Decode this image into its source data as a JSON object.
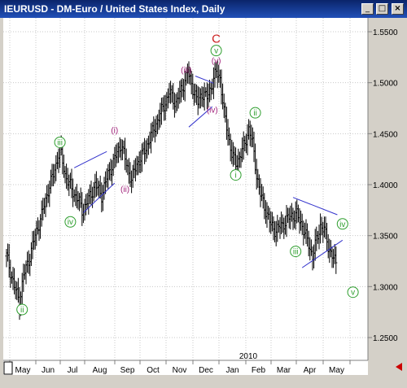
{
  "window": {
    "title": "IEURUSD - DM-Euro / United States Index, Daily",
    "minimize_icon": "minimize-icon",
    "maximize_icon": "maximize-icon",
    "close_icon": "close-icon"
  },
  "scroll_arrow_color": "#cc0000",
  "colors": {
    "wave_green": "#2e9e2e",
    "wave_purple": "#a0207a",
    "wave_red": "#cc2222",
    "trendline": "#3333cc",
    "bars": "#000000"
  },
  "chart_data": {
    "type": "ohlc-bar",
    "symbol": "IEURUSD",
    "title": "IEURUSD - DM-Euro / United States Index, Daily",
    "x_axis": {
      "months": [
        "May",
        "Jun",
        "Jul",
        "Aug",
        "Sep",
        "Oct",
        "Nov",
        "Dec",
        "Jan",
        "Feb",
        "Mar",
        "Apr",
        "May"
      ],
      "year_label": "2010"
    },
    "y_axis": {
      "ticks": [
        "1.5500",
        "1.5000",
        "1.4500",
        "1.4000",
        "1.3500",
        "1.3000",
        "1.2500"
      ],
      "ylim": [
        1.22,
        1.565
      ]
    },
    "price_path": [
      [
        0,
        1.33
      ],
      [
        6,
        1.3
      ],
      [
        10,
        1.285
      ],
      [
        13,
        1.31
      ],
      [
        18,
        1.33
      ],
      [
        22,
        1.35
      ],
      [
        27,
        1.37
      ],
      [
        32,
        1.395
      ],
      [
        36,
        1.41
      ],
      [
        41,
        1.435
      ],
      [
        45,
        1.41
      ],
      [
        50,
        1.395
      ],
      [
        55,
        1.385
      ],
      [
        58,
        1.375
      ],
      [
        63,
        1.385
      ],
      [
        68,
        1.4
      ],
      [
        73,
        1.39
      ],
      [
        78,
        1.41
      ],
      [
        83,
        1.425
      ],
      [
        88,
        1.44
      ],
      [
        92,
        1.42
      ],
      [
        96,
        1.405
      ],
      [
        100,
        1.42
      ],
      [
        105,
        1.43
      ],
      [
        110,
        1.445
      ],
      [
        115,
        1.46
      ],
      [
        120,
        1.475
      ],
      [
        125,
        1.49
      ],
      [
        130,
        1.48
      ],
      [
        135,
        1.495
      ],
      [
        139,
        1.51
      ],
      [
        143,
        1.495
      ],
      [
        147,
        1.48
      ],
      [
        150,
        1.49
      ],
      [
        154,
        1.485
      ],
      [
        158,
        1.5
      ],
      [
        161,
        1.51
      ],
      [
        164,
        1.505
      ],
      [
        167,
        1.47
      ],
      [
        170,
        1.45
      ],
      [
        173,
        1.43
      ],
      [
        176,
        1.42
      ],
      [
        180,
        1.43
      ],
      [
        183,
        1.44
      ],
      [
        186,
        1.455
      ],
      [
        189,
        1.44
      ],
      [
        192,
        1.41
      ],
      [
        195,
        1.39
      ],
      [
        199,
        1.375
      ],
      [
        203,
        1.36
      ],
      [
        207,
        1.355
      ],
      [
        211,
        1.36
      ],
      [
        215,
        1.365
      ],
      [
        219,
        1.37
      ],
      [
        223,
        1.37
      ],
      [
        227,
        1.36
      ],
      [
        231,
        1.345
      ],
      [
        235,
        1.33
      ],
      [
        238,
        1.345
      ],
      [
        241,
        1.36
      ],
      [
        244,
        1.355
      ],
      [
        247,
        1.34
      ],
      [
        250,
        1.33
      ],
      [
        253,
        1.322
      ]
    ],
    "wave_labels": [
      {
        "text": "C",
        "x": 161,
        "price": 1.5435,
        "color": "red",
        "shape": "plain",
        "size": "large"
      },
      {
        "text": "v",
        "x": 161,
        "price": 1.5315,
        "color": "green",
        "shape": "circle"
      },
      {
        "text": "(v)",
        "x": 161,
        "price": 1.5215,
        "color": "purple",
        "shape": "plain"
      },
      {
        "text": "(iii)",
        "x": 138,
        "price": 1.5125,
        "color": "purple",
        "shape": "plain"
      },
      {
        "text": "(iv)",
        "x": 158,
        "price": 1.4735,
        "color": "purple",
        "shape": "plain"
      },
      {
        "text": "(i)",
        "x": 83,
        "price": 1.4535,
        "color": "purple",
        "shape": "plain"
      },
      {
        "text": "(ii)",
        "x": 91,
        "price": 1.3955,
        "color": "purple",
        "shape": "plain"
      },
      {
        "text": "iii",
        "x": 41,
        "price": 1.4415,
        "color": "green",
        "shape": "circle"
      },
      {
        "text": "iv",
        "x": 49,
        "price": 1.3635,
        "color": "green",
        "shape": "circle"
      },
      {
        "text": "ii",
        "x": 12,
        "price": 1.2775,
        "color": "green",
        "shape": "circle"
      },
      {
        "text": "ii",
        "x": 191,
        "price": 1.4705,
        "color": "green",
        "shape": "circle"
      },
      {
        "text": "i",
        "x": 176,
        "price": 1.4095,
        "color": "green",
        "shape": "circle"
      },
      {
        "text": "iii",
        "x": 222,
        "price": 1.3345,
        "color": "green",
        "shape": "circle"
      },
      {
        "text": "iv",
        "x": 258,
        "price": 1.3615,
        "color": "green",
        "shape": "circle"
      },
      {
        "text": "v",
        "x": 266,
        "price": 1.2945,
        "color": "green",
        "shape": "circle"
      }
    ],
    "trendlines": [
      [
        [
          52,
          1.4165
        ],
        [
          77,
          1.4325
        ]
      ],
      [
        [
          59,
          1.3725
        ],
        [
          83,
          1.4015
        ]
      ],
      [
        [
          145,
          1.5065
        ],
        [
          159,
          1.4995
        ]
      ],
      [
        [
          140,
          1.4565
        ],
        [
          158,
          1.4765
        ]
      ],
      [
        [
          220,
          1.3875
        ],
        [
          254,
          1.3705
        ]
      ],
      [
        [
          227,
          1.3185
        ],
        [
          258,
          1.3455
        ]
      ]
    ]
  }
}
